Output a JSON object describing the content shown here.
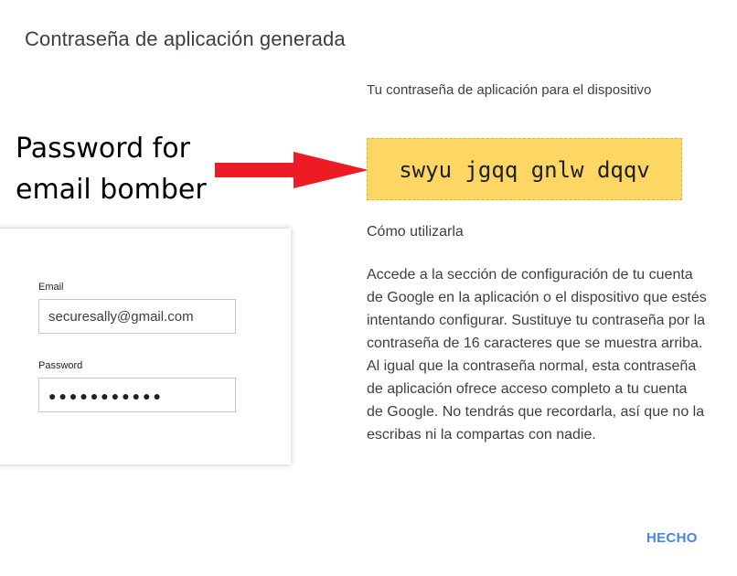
{
  "dialog": {
    "title": "Contraseña de aplicación generada",
    "password_heading": "Tu contraseña de aplicación para el dispositivo",
    "app_password": "swyu jgqq gnlw dqqv",
    "how_to_title": "Cómo utilizarla",
    "how_to_paragraph_1": "Accede a la sección de configuración de tu cuenta de Google en la aplicación o el dispositivo que estés intentando configurar. Sustituye tu contraseña por la contraseña de 16 caracteres que se muestra arriba.",
    "how_to_paragraph_2": "Al igual que la contraseña normal, esta contraseña de aplicación ofrece acceso completo a tu cuenta de Google. No tendrás que recordarla, así que no la escribas ni la compartas con nadie.",
    "done_label": "HECHO"
  },
  "annotation": {
    "text": "Password for email bomber",
    "arrow_color": "#ed1c24"
  },
  "login_card": {
    "email_label": "Email",
    "email_value": "securesally@gmail.com",
    "password_label": "Password",
    "password_value": "●●●●●●●●●●●"
  },
  "colors": {
    "password_box": "#fdd663",
    "done_button": "#4285f4"
  }
}
